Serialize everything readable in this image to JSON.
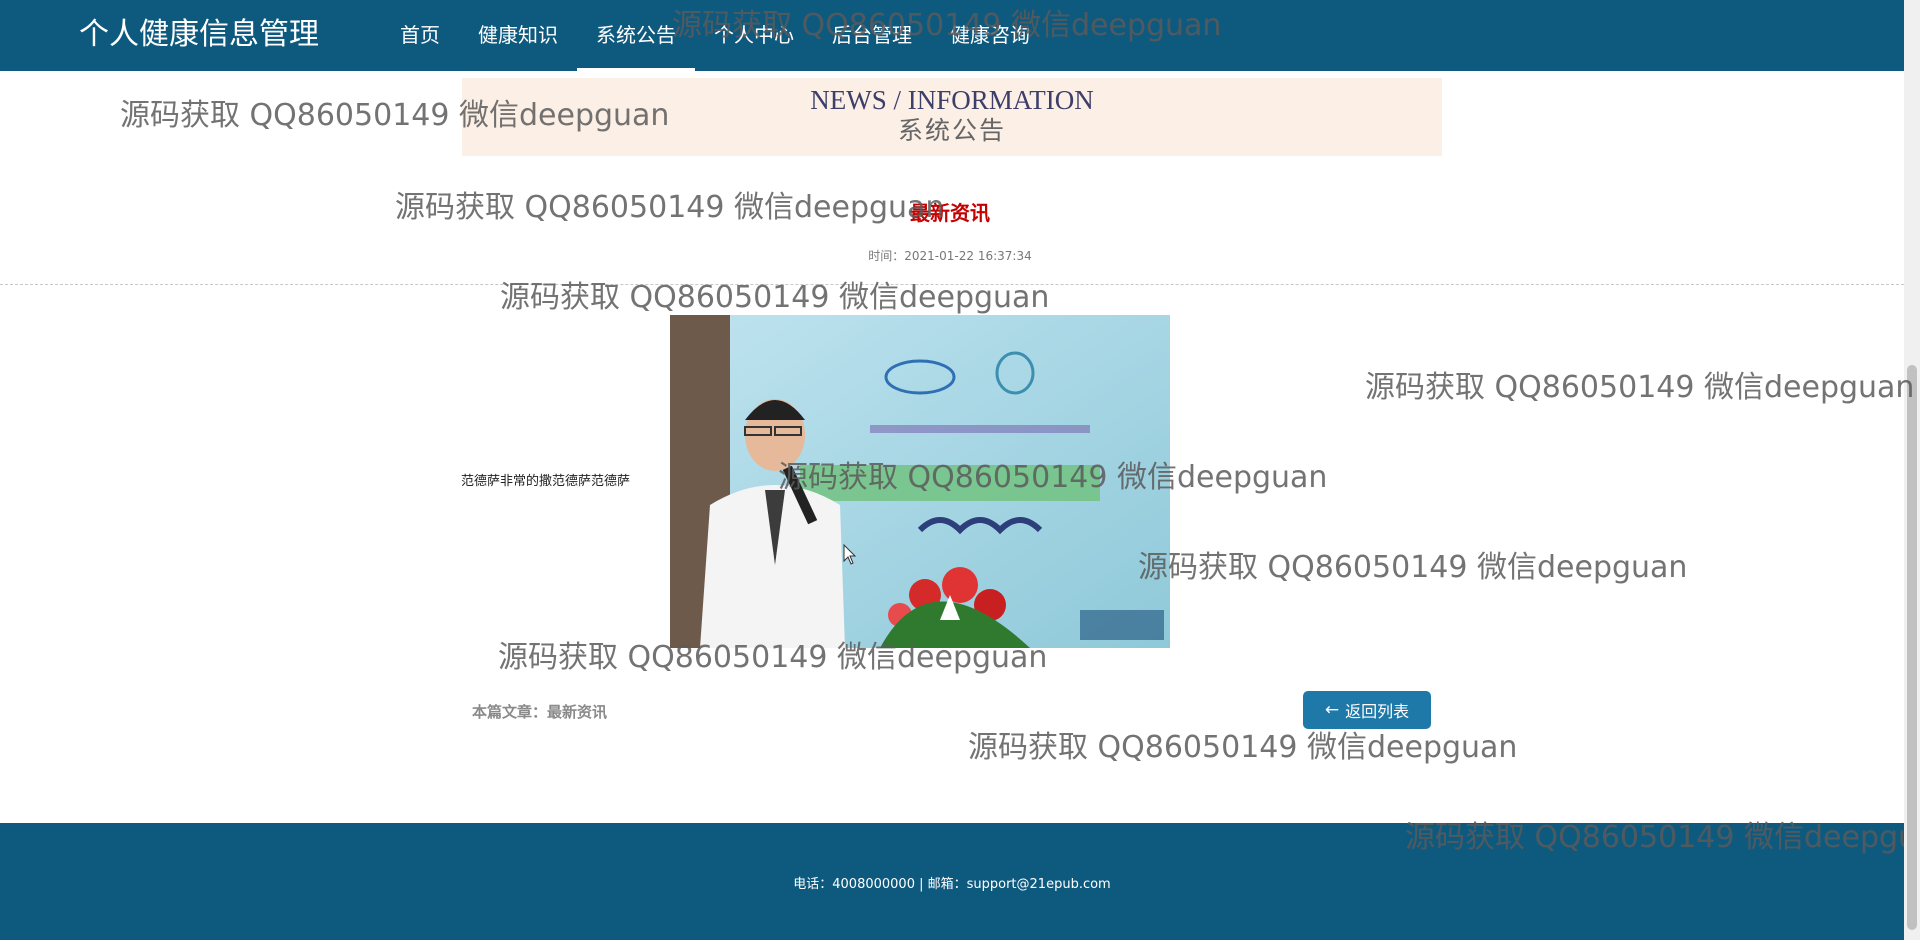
{
  "header": {
    "brand": "个人健康信息管理",
    "nav": [
      "首页",
      "健康知识",
      "系统公告",
      "个人中心",
      "后台管理",
      "健康咨询"
    ],
    "active_index": 2
  },
  "banner": {
    "title_en": "NEWS / INFORMATION",
    "title_cn": "系统公告"
  },
  "article": {
    "title": "最新资讯",
    "time": "时间：2021-01-22 16:37:34",
    "content_text": "范德萨非常的撒范德萨范德萨",
    "image_icon": "news-photo-icon",
    "footnote": "本篇文章：最新资讯",
    "back_label": "返回列表"
  },
  "footer": {
    "contact": "电话：4008000000 | 邮箱：support@21epub.com"
  },
  "watermark_text": "源码获取 QQ86050149 微信deepguan",
  "colors": {
    "nav_bg": "#0e5a7f",
    "banner_bg": "#fcefe6",
    "title_red": "#c40000",
    "button_blue": "#1e78a8"
  }
}
